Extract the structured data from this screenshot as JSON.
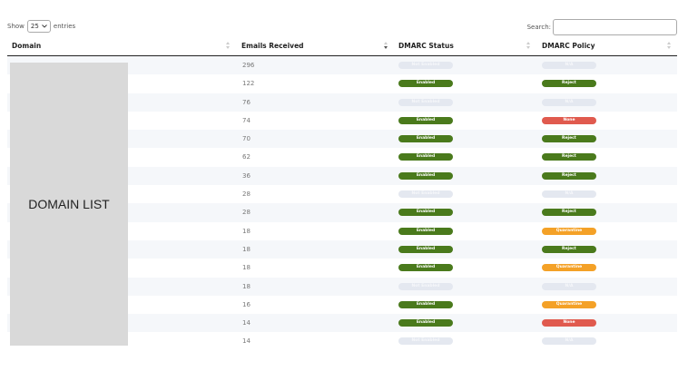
{
  "controls": {
    "show_label": "Show",
    "entries_value": "25",
    "entries_label": "entries",
    "search_label": "Search:",
    "search_value": ""
  },
  "table": {
    "headers": [
      "Domain",
      "Emails Received",
      "DMARC Status",
      "DMARC Policy"
    ],
    "domain_placeholder": "DOMAIN LIST",
    "rows": [
      {
        "emails": "296",
        "status": "Not Enabled",
        "policy": "N/A"
      },
      {
        "emails": "122",
        "status": "Enabled",
        "policy": "Reject"
      },
      {
        "emails": "76",
        "status": "Not Enabled",
        "policy": "N/A"
      },
      {
        "emails": "74",
        "status": "Enabled",
        "policy": "None"
      },
      {
        "emails": "70",
        "status": "Enabled",
        "policy": "Reject"
      },
      {
        "emails": "62",
        "status": "Enabled",
        "policy": "Reject"
      },
      {
        "emails": "36",
        "status": "Enabled",
        "policy": "Reject"
      },
      {
        "emails": "28",
        "status": "Not Enabled",
        "policy": "N/A"
      },
      {
        "emails": "28",
        "status": "Enabled",
        "policy": "Reject"
      },
      {
        "emails": "18",
        "status": "Enabled",
        "policy": "Quarantine"
      },
      {
        "emails": "18",
        "status": "Enabled",
        "policy": "Reject"
      },
      {
        "emails": "18",
        "status": "Enabled",
        "policy": "Quarantine"
      },
      {
        "emails": "18",
        "status": "Not Enabled",
        "policy": "N/A"
      },
      {
        "emails": "16",
        "status": "Enabled",
        "policy": "Quarantine"
      },
      {
        "emails": "14",
        "status": "Enabled",
        "policy": "None"
      },
      {
        "emails": "14",
        "status": "Not Enabled",
        "policy": "N/A"
      }
    ]
  },
  "colors": {
    "enabled": "#4a7a1c",
    "reject": "#4a7a1c",
    "none": "#e05a4e",
    "quarantine": "#f4a127",
    "not_enabled": "#e4e8f0"
  },
  "icons": {
    "select_caret": "chevron-down-icon",
    "sort": "sort-icon"
  }
}
